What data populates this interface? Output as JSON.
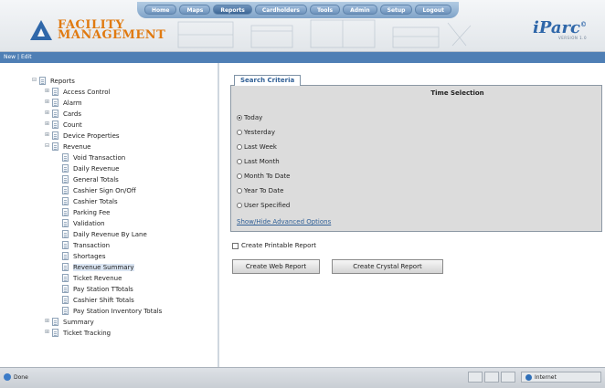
{
  "nav": {
    "items": [
      "Home",
      "Maps",
      "Reports",
      "Cardholders",
      "Tools",
      "Admin",
      "Setup",
      "Logout"
    ],
    "active": "Reports"
  },
  "logo": {
    "line1": "FACILITY",
    "line2": "MANAGEMENT"
  },
  "brand": {
    "name": "iParc",
    "version": "VERSION 1.0"
  },
  "toolbar": {
    "new_label": "New",
    "sep": " | ",
    "edit_label": "Edit"
  },
  "tree": {
    "root": "Reports",
    "items": [
      "Access Control",
      "Alarm",
      "Cards",
      "Count",
      "Device Properties",
      "Revenue",
      "Void Transaction",
      "Daily Revenue",
      "General Totals",
      "Cashier Sign On/Off",
      "Cashier Totals",
      "Parking Fee",
      "Validation",
      "Daily Revenue By Lane",
      "Transaction",
      "Shortages",
      "Revenue Summary",
      "Ticket Revenue",
      "Pay Station TTotals",
      "Cashier Shift Totals",
      "Pay Station Inventory Totals",
      "Summary",
      "Ticket Tracking"
    ],
    "selected": "Revenue Summary"
  },
  "search": {
    "tab_label": "Search Criteria",
    "section_title": "Time Selection",
    "options": [
      "Today",
      "Yesterday",
      "Last Week",
      "Last Month",
      "Month To Date",
      "Year To Date",
      "User Specified"
    ],
    "selected": "Today",
    "advanced_link": "Show/Hide Advanced Options"
  },
  "printable_label": "Create Printable Report",
  "buttons": {
    "web": "Create Web Report",
    "crystal": "Create Crystal Report"
  },
  "status": {
    "left": "Done",
    "zone": "Internet"
  },
  "colors": {
    "accent": "#4f7fb5",
    "logo_orange": "#e07a10",
    "brand_blue": "#2f67a9"
  }
}
